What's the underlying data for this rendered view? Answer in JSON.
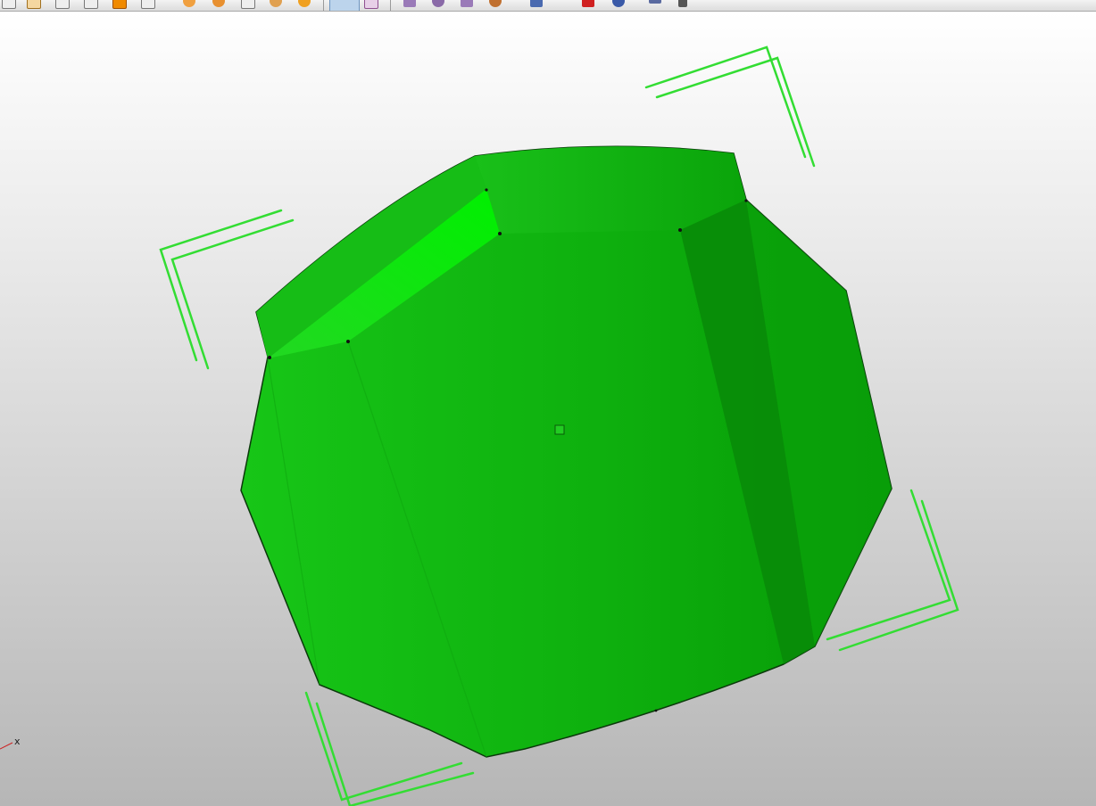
{
  "toolbar": {
    "icons": [
      "new-file-icon",
      "open-file-icon",
      "save-file-icon",
      "save-as-icon",
      "import-icon",
      "export-icon",
      "rotate-view-icon",
      "pan-view-icon",
      "zoom-box-icon",
      "fit-view-icon",
      "zoom-icon",
      "select-tool-icon",
      "measure-tool-icon",
      "section-icon",
      "mirror-icon",
      "transform-icon",
      "shading-icon",
      "flask-icon",
      "pin-icon",
      "help-icon",
      "line-style-icon",
      "dropdown-arrow-icon"
    ],
    "active_icon": "select-tool-icon"
  },
  "viewport": {
    "axis_label": "x",
    "model_color": "#1fb81f",
    "highlight_color": "#00ee00",
    "bracket_color": "#33dd33",
    "background_top": "#ffffff",
    "background_bottom": "#b6b6b6"
  }
}
